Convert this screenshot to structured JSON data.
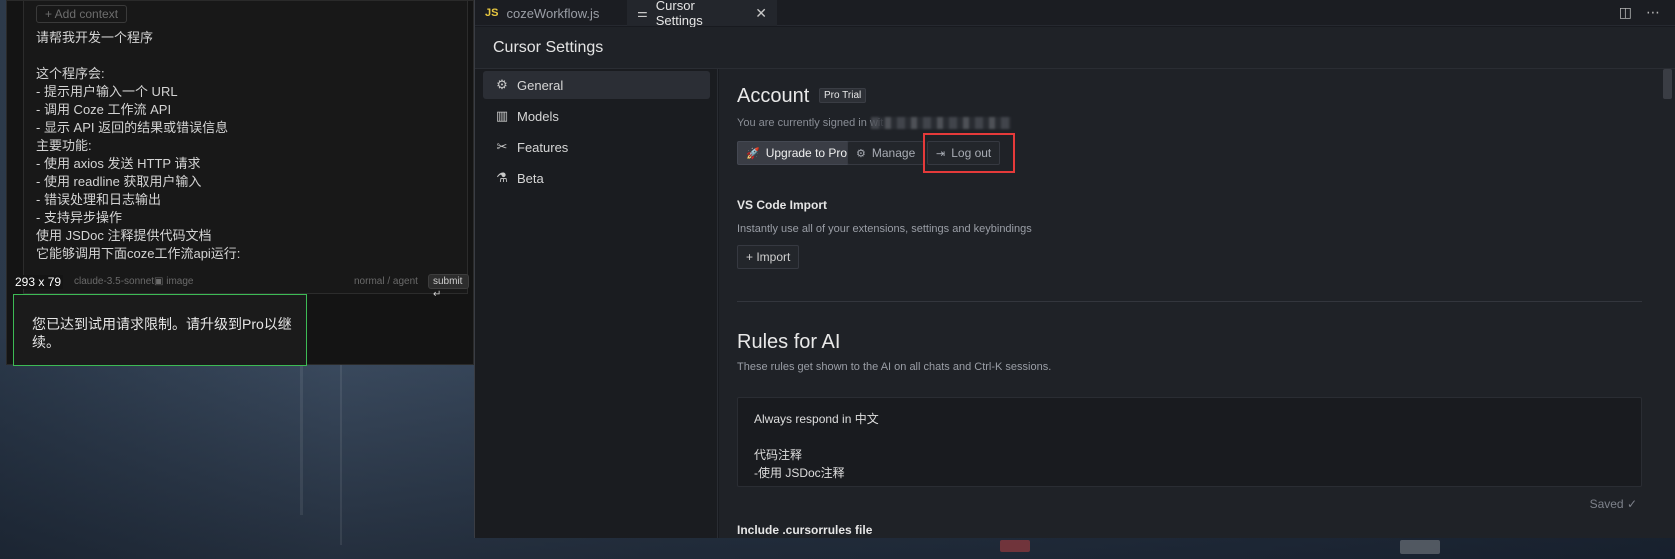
{
  "chat": {
    "add_context": "+ Add context",
    "lines": [
      "请帮我开发一个程序",
      "",
      "这个程序会:",
      "- 提示用户输入一个 URL",
      "- 调用 Coze 工作流 API",
      "- 显示 API 返回的结果或错误信息",
      "主要功能:",
      "- 使用 axios 发送 HTTP 请求",
      "- 使用 readline 获取用户输入",
      "- 错误处理和日志输出",
      "- 支持异步操作",
      "使用 JSDoc 注释提供代码文档",
      "它能够调用下面coze工作流api运行:",
      ""
    ],
    "dims": "293 x 79",
    "model": "claude-3.5-sonnet",
    "image_label": "image",
    "mode": "normal / agent",
    "submit": "submit"
  },
  "trial_notice": "您已达到试用请求限制。请升级到Pro以继续。",
  "tabs": [
    {
      "badge": "JS",
      "label": "cozeWorkflow.js"
    },
    {
      "label": "Cursor Settings",
      "close": "✕"
    }
  ],
  "settings": {
    "title": "Cursor Settings",
    "nav": [
      {
        "icon": "gear-icon",
        "label": "General"
      },
      {
        "icon": "bar-chart-icon",
        "label": "Models"
      },
      {
        "icon": "tools-icon",
        "label": "Features"
      },
      {
        "icon": "flask-icon",
        "label": "Beta"
      }
    ],
    "account": {
      "title": "Account",
      "badge": "Pro Trial",
      "signed_in": "You are currently signed in wit",
      "upgrade": "Upgrade to Pro",
      "manage": "Manage",
      "logout": "Log out"
    },
    "vscode_import": {
      "title": "VS Code Import",
      "desc": "Instantly use all of your extensions, settings and keybindings",
      "button": "+ Import"
    },
    "rules": {
      "title": "Rules for AI",
      "desc": "These rules get shown to the AI on all chats and Ctrl-K sessions.",
      "text": "Always respond in 中文\n\n代码注释\n-使用 JSDoc注释",
      "saved": "Saved ✓",
      "include_label": "Include .cursorrules file"
    }
  },
  "colors": {
    "highlight": "#e53a3a",
    "notice_border": "#3dbb55",
    "js_badge": "#e8c840"
  }
}
